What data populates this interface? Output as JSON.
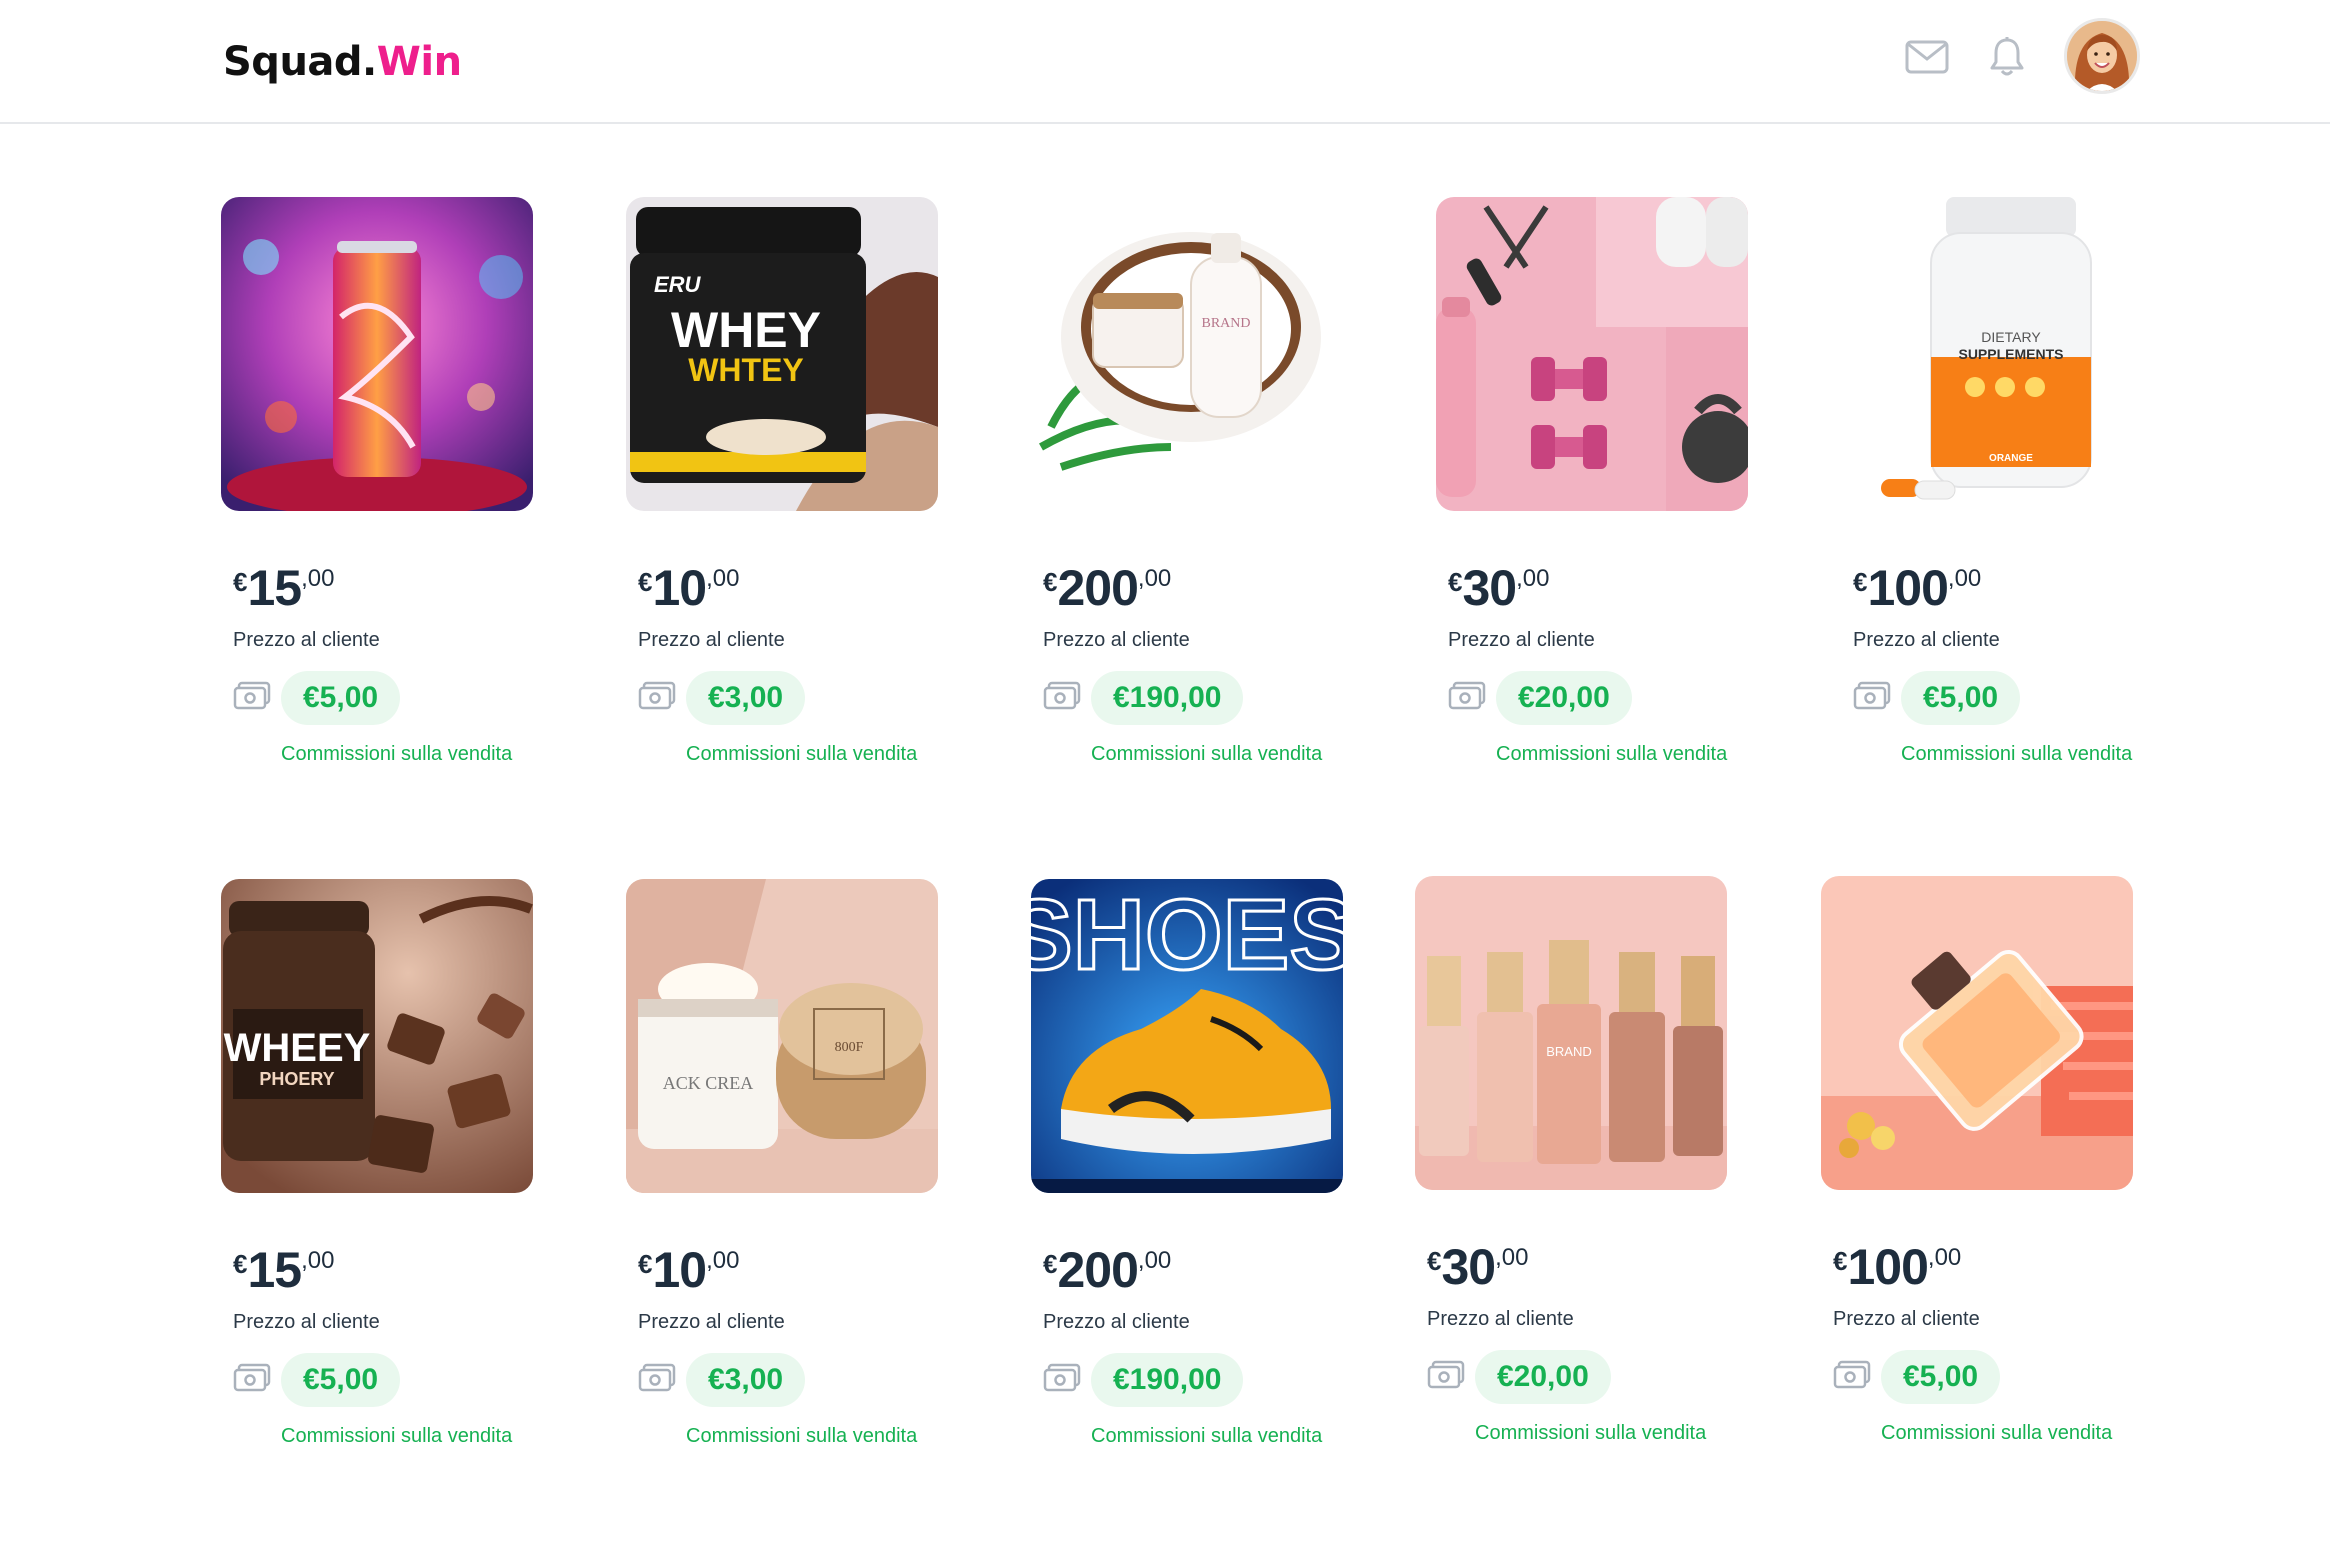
{
  "brand": {
    "part1": "Squad.",
    "part2": "Win"
  },
  "header": {
    "mail_icon": "mail-icon",
    "bell_icon": "bell-icon",
    "avatar": "user-avatar"
  },
  "colors": {
    "brand_pink": "#ee1f8c",
    "commission_green": "#16b152",
    "commission_bg": "#e9f8ee",
    "text_dark": "#1e2d3d"
  },
  "products": [
    {
      "image": "energy-drink-can",
      "currency": "€",
      "price_int": "15",
      "price_dec": ",00",
      "price_label": "Prezzo al cliente",
      "commission": "€5,00",
      "commission_label": "Commissioni sulla vendita"
    },
    {
      "image": "whey-protein-tub",
      "currency": "€",
      "price_int": "10",
      "price_dec": ",00",
      "price_label": "Prezzo al cliente",
      "commission": "€3,00",
      "commission_label": "Commissioni sulla vendita"
    },
    {
      "image": "coconut-cosmetics",
      "currency": "€",
      "price_int": "200",
      "price_dec": ",00",
      "price_label": "Prezzo al cliente",
      "commission": "€190,00",
      "commission_label": "Commissioni sulla vendita"
    },
    {
      "image": "pink-fitness-set",
      "currency": "€",
      "price_int": "30",
      "price_dec": ",00",
      "price_label": "Prezzo al cliente",
      "commission": "€20,00",
      "commission_label": "Commissioni sulla vendita"
    },
    {
      "image": "dietary-supplements-bottle",
      "currency": "€",
      "price_int": "100",
      "price_dec": ",00",
      "price_label": "Prezzo al cliente",
      "commission": "€5,00",
      "commission_label": "Commissioni sulla vendita"
    },
    {
      "image": "chocolate-whey-tub",
      "currency": "€",
      "price_int": "15",
      "price_dec": ",00",
      "price_label": "Prezzo al cliente",
      "commission": "€5,00",
      "commission_label": "Commissioni sulla vendita"
    },
    {
      "image": "face-cream-jars",
      "currency": "€",
      "price_int": "10",
      "price_dec": ",00",
      "price_label": "Prezzo al cliente",
      "commission": "€3,00",
      "commission_label": "Commissioni sulla vendita"
    },
    {
      "image": "sneaker-shoes-poster",
      "currency": "€",
      "price_int": "200",
      "price_dec": ",00",
      "price_label": "Prezzo al cliente",
      "commission": "€190,00",
      "commission_label": "Commissioni sulla vendita"
    },
    {
      "image": "foundation-bottles",
      "currency": "€",
      "price_int": "30",
      "price_dec": ",00",
      "price_label": "Prezzo al cliente",
      "commission": "€20,00",
      "commission_label": "Commissioni sulla vendita"
    },
    {
      "image": "perfume-bottle",
      "currency": "€",
      "price_int": "100",
      "price_dec": ",00",
      "price_label": "Prezzo al cliente",
      "commission": "€5,00",
      "commission_label": "Commissioni sulla vendita"
    }
  ],
  "image_text": {
    "whey1": "WHEY",
    "whey1b": "WHTEY",
    "supp": "DIETARY",
    "supp2": "SUPPLEMENTS",
    "supp3": "ORANGE",
    "whey2": "WHEEY",
    "whey2b": "PHOERY",
    "shoes": "SHOES",
    "cream": "ACK CREA",
    "found": "BRAND"
  }
}
